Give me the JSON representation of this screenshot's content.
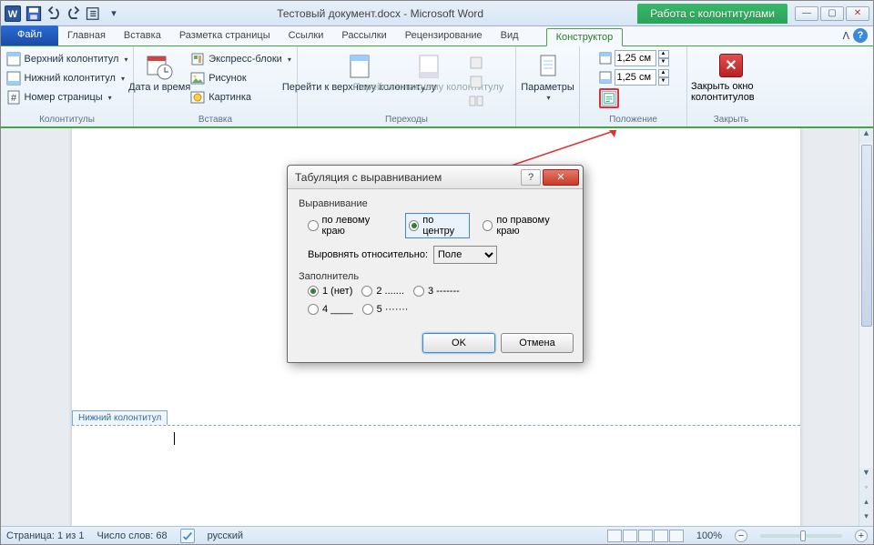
{
  "app": {
    "title": "Тестовый документ.docx  -  Microsoft Word",
    "contextual_tab": "Работа с колонтитулами"
  },
  "tabs": {
    "file": "Файл",
    "home": "Главная",
    "insert": "Вставка",
    "layout": "Разметка страницы",
    "references": "Ссылки",
    "mailings": "Рассылки",
    "review": "Рецензирование",
    "view": "Вид",
    "design": "Конструктор"
  },
  "ribbon": {
    "headers": {
      "header": "Верхний колонтитул",
      "footer": "Нижний колонтитул",
      "page_number": "Номер страницы",
      "group": "Колонтитулы"
    },
    "insert": {
      "datetime": "Дата и время",
      "quickparts": "Экспресс-блоки",
      "picture": "Рисунок",
      "clipart": "Картинка",
      "group": "Вставка"
    },
    "nav": {
      "gotoheader": "Перейти к верхнему колонтитулу",
      "gotofooter": "Перейти к нижнему колонтитулу",
      "group": "Переходы"
    },
    "options": {
      "label": "Параметры",
      "group": ""
    },
    "position": {
      "top": "1,25 см",
      "bottom": "1,25 см",
      "group": "Положение"
    },
    "close": {
      "label": "Закрыть окно колонтитулов",
      "group": "Закрыть"
    }
  },
  "page": {
    "footer_tab": "Нижний колонтитул"
  },
  "dialog": {
    "title": "Табуляция с выравниванием",
    "alignment_label": "Выравнивание",
    "align_left": "по левому краю",
    "align_center": "по центру",
    "align_right": "по правому краю",
    "relative_label": "Выровнять относительно:",
    "relative_value": "Поле",
    "leader_label": "Заполнитель",
    "leader1": "1 (нет)",
    "leader2": "2 .......",
    "leader3": "3 -------",
    "leader4": "4 ____",
    "leader5": "5 ·······",
    "ok": "OK",
    "cancel": "Отмена"
  },
  "status": {
    "page": "Страница: 1 из 1",
    "words": "Число слов: 68",
    "lang": "русский",
    "zoom": "100%"
  }
}
